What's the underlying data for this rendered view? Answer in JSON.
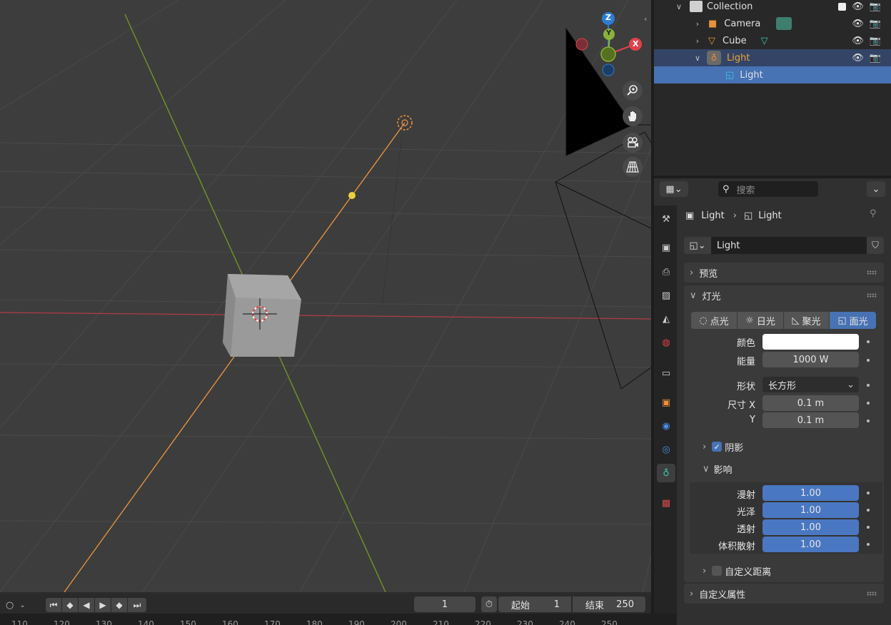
{
  "outliner": {
    "collection": "Collection",
    "items": [
      {
        "label": "Camera"
      },
      {
        "label": "Cube"
      },
      {
        "label": "Light"
      },
      {
        "label": "Light"
      }
    ]
  },
  "properties": {
    "search_placeholder": "搜索",
    "breadcrumb": {
      "object": "Light",
      "data": "Light"
    },
    "datablock_name": "Light",
    "panels": {
      "preview": "预览",
      "light": "灯光",
      "shadow": "阴影",
      "influence": "影响",
      "custom_distance": "自定义距离",
      "custom_props": "自定义属性"
    },
    "light_types": [
      "点光",
      "日光",
      "聚光",
      "面光"
    ],
    "active_type": "面光",
    "color_label": "颜色",
    "color_value": "#ffffff",
    "energy_label": "能量",
    "energy_value": "1000 W",
    "shape_label": "形状",
    "shape_value": "长方形",
    "size_x_label": "尺寸 X",
    "size_x_value": "0.1 m",
    "size_y_label": "Y",
    "size_y_value": "0.1 m",
    "shadow_checked": true,
    "influence": [
      {
        "label": "漫射",
        "value": "1.00"
      },
      {
        "label": "光泽",
        "value": "1.00"
      },
      {
        "label": "透射",
        "value": "1.00"
      },
      {
        "label": "体积散射",
        "value": "1.00"
      }
    ]
  },
  "gizmo": {
    "z": "Z",
    "y": "Y",
    "x": "X"
  },
  "timeline": {
    "current_frame": "1",
    "start_label": "起始",
    "start_value": "1",
    "end_label": "结束",
    "end_value": "250",
    "ruler_ticks": [
      "110",
      "120",
      "130",
      "140",
      "150",
      "160",
      "170",
      "180",
      "190",
      "200",
      "210",
      "220",
      "230",
      "240",
      "250"
    ]
  },
  "colors": {
    "accent": "#4772b3",
    "orange": "#f0953e",
    "x_axis": "#e2414a",
    "y_axis": "#8ab236",
    "z_axis": "#2b7dd6"
  }
}
